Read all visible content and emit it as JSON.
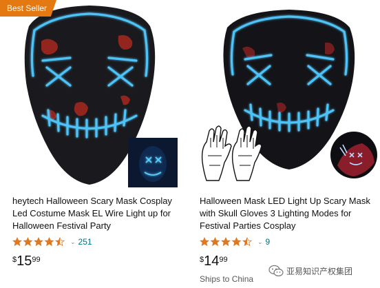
{
  "products": [
    {
      "badge": "Best Seller",
      "title": "heytech Halloween Scary Mask Cosplay Led Costume Mask EL Wire Light up for Halloween Festival Party",
      "rating": 4.5,
      "rating_count": "251",
      "price": {
        "symbol": "$",
        "whole": "15",
        "fraction": "99"
      },
      "image_icon": "led-mask-image"
    },
    {
      "title": "Halloween Mask LED Light Up Scary Mask with Skull Gloves 3 Lighting Modes for Festival Parties Cosplay",
      "rating": 4.5,
      "rating_count": "9",
      "price": {
        "symbol": "$",
        "whole": "14",
        "fraction": "99"
      },
      "shipping": "Ships to China",
      "image_icon": "led-mask-with-gloves-image"
    }
  ],
  "watermark": {
    "text": "亚易知识产权集团",
    "icon": "wechat-icon"
  },
  "colors": {
    "badge": "#e47911",
    "star": "#de7921",
    "link": "#007185",
    "led": "#4fc3f7"
  }
}
